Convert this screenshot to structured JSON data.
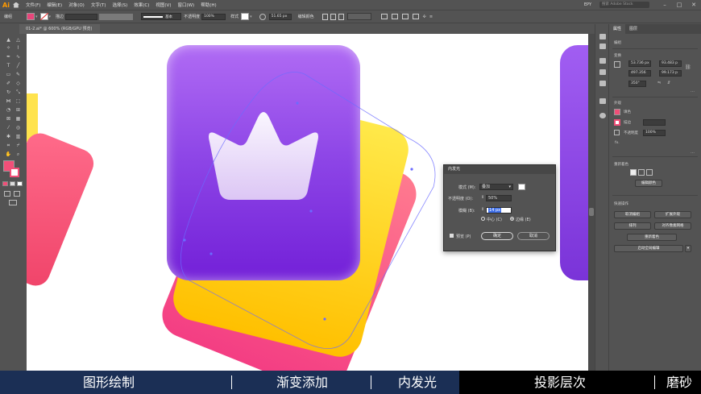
{
  "app": {
    "logo": "Ai",
    "workspace": "EPY",
    "search_placeholder": "搜索 Adobe Stock"
  },
  "menu": [
    "文件(F)",
    "编辑(E)",
    "对象(O)",
    "文字(T)",
    "选择(S)",
    "效果(C)",
    "视图(V)",
    "窗口(W)",
    "帮助(H)"
  ],
  "control_bar": {
    "label": "编组",
    "stroke_label": "描边",
    "brush_label": "基本",
    "opacity_label": "不透明度",
    "opacity_value": "100%",
    "style_label": "样式",
    "width_value": "51.65 px",
    "recolor_label": "编辑颜色"
  },
  "document": {
    "tab_title": "01-2.ai* @ 600% (RGB/GPU 预览)"
  },
  "panel": {
    "tabs": [
      "属性",
      "图层"
    ],
    "selection": "编组",
    "transform_label": "变换",
    "x_value": "53.736 px",
    "y_value": "497.356",
    "w_value": "93.483 p",
    "h_value": "99.173 p",
    "angle_value": "350°",
    "appearance_label": "外观",
    "fill_label": "填色",
    "stroke_label": "描边",
    "opacity_label": "不透明度",
    "opacity_value": "100%",
    "fx_label": "fx.",
    "recolor_section": "重新着色",
    "recolor_button": "编辑颜色",
    "quick_actions_label": "快速操作",
    "buttons": [
      "取消编组",
      "扩展外观",
      "排列",
      "对齐像素网格",
      "重新着色",
      "启动全局编辑"
    ]
  },
  "dialog": {
    "title": "内发光",
    "mode_label": "模式 (M):",
    "mode_value": "叠加",
    "opacity_label": "不透明度 (O):",
    "opacity_value": "50%",
    "blur_label": "模糊 (B):",
    "blur_value": "14 px",
    "center_label": "中心 (C)",
    "edge_label": "边缘 (E)",
    "preview_label": "预览 (P)",
    "ok": "确定",
    "cancel": "取消"
  },
  "captions": [
    "图形绘制",
    "渐变添加",
    "内发光",
    "投影层次",
    "磨砂"
  ],
  "colors": {
    "purple_top": "#b06bf4",
    "purple_bottom": "#7320d8",
    "yellow": "#ffd21a",
    "pink": "#f4527f",
    "caption_bg": "#1b2f55"
  }
}
